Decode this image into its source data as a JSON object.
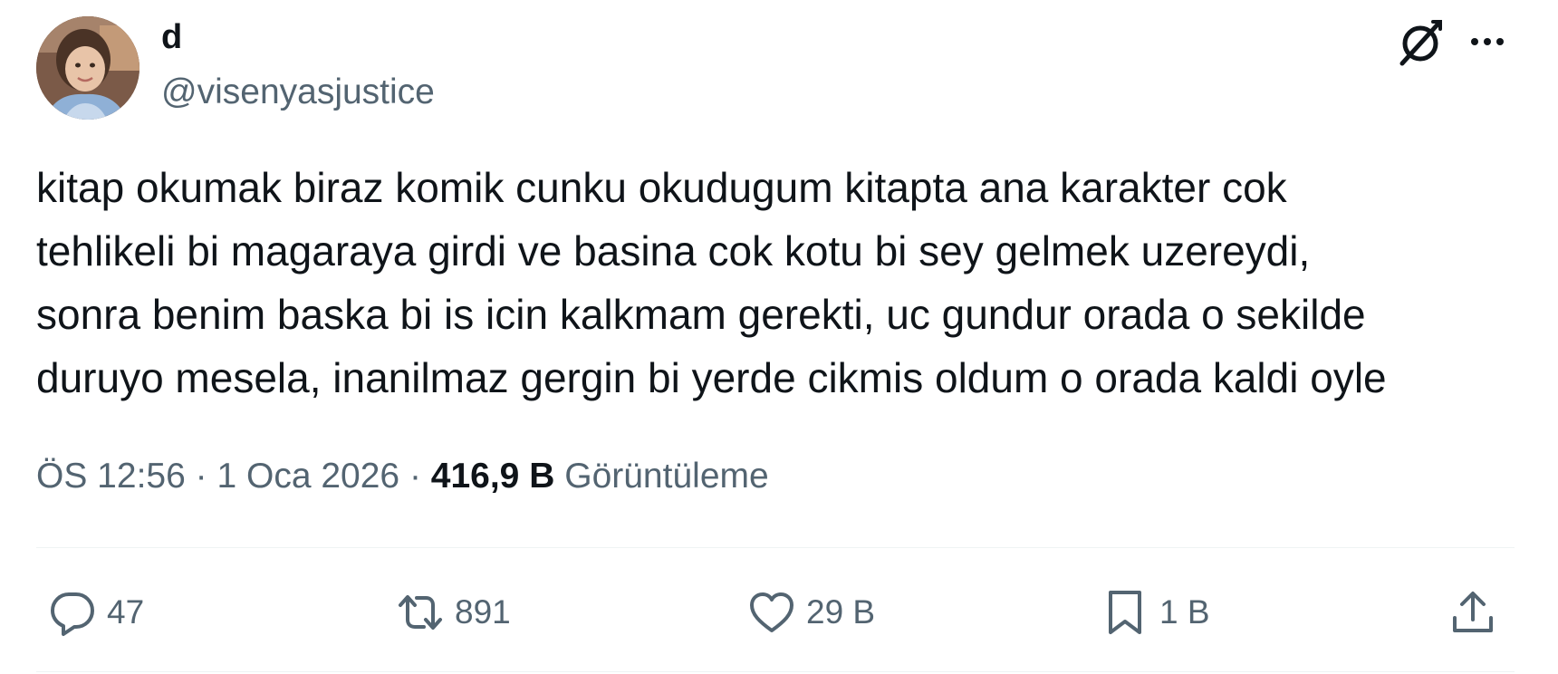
{
  "author": {
    "display_name": "d",
    "handle": "@visenyasjustice"
  },
  "tweet": {
    "text": "kitap okumak biraz komik cunku okudugum kitapta ana karakter cok\ntehlikeli bi magaraya girdi ve basina cok kotu bi sey gelmek uzereydi,\nsonra benim baska bi is icin kalkmam gerekti, uc gundur orada o sekilde\nduruyo mesela, inanilmaz gergin bi yerde cikmis oldum o orada kaldi oyle"
  },
  "meta": {
    "time": "ÖS 12:56",
    "separator": " · ",
    "date": "1 Oca 2026",
    "views_count": "416,9 B",
    "views_label": "Görüntüleme"
  },
  "actions": {
    "reply_count": "47",
    "retweet_count": "891",
    "like_count": "29 B",
    "bookmark_count": "1 B"
  },
  "icons": {
    "grok": "grok-icon",
    "more": "more-dots-icon",
    "reply": "reply-bubble-icon",
    "retweet": "retweet-icon",
    "like": "heart-icon",
    "bookmark": "bookmark-icon",
    "share": "share-upload-icon"
  },
  "colors": {
    "text_primary": "#0f1419",
    "text_secondary": "#536471",
    "divider": "#eff3f4"
  }
}
